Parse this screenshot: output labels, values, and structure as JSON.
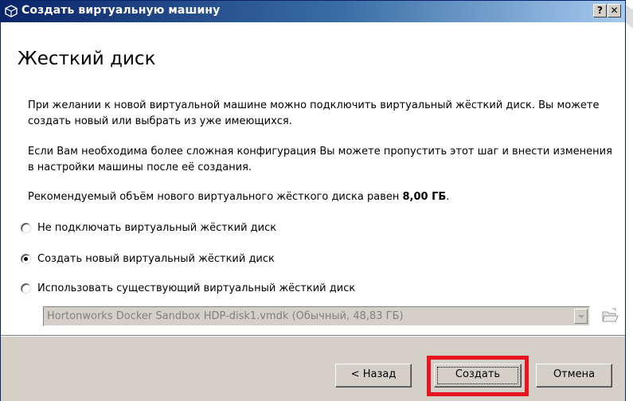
{
  "window": {
    "title": "Создать виртуальную машину",
    "help_label": "?",
    "close_label": "✕"
  },
  "page": {
    "heading": "Жесткий диск",
    "para1": "При желании к новой виртуальной машине можно подключить виртуальный жёсткий диск. Вы можете создать новый или выбрать из уже имеющихся.",
    "para2": "Если Вам необходима более сложная конфигурация Вы можете пропустить этот шаг и внести изменения в настройки машины после её создания.",
    "recommended_prefix": "Рекомендуемый объём нового виртуального жёсткого диска равен ",
    "recommended_size": "8,00 ГБ",
    "recommended_suffix": "."
  },
  "options": [
    {
      "label": "Не подключать виртуальный жёсткий диск",
      "checked": false
    },
    {
      "label": "Создать новый виртуальный жёсткий диск",
      "checked": true
    },
    {
      "label": "Использовать существующий виртуальный жёсткий диск",
      "checked": false
    }
  ],
  "disk_select": {
    "value": "Hortonworks Docker Sandbox HDP-disk1.vmdk (Обычный, 48,83 ГБ)",
    "enabled": false
  },
  "buttons": {
    "back": "< Назад",
    "create": "Создать",
    "cancel": "Отмена"
  },
  "colors": {
    "title_gradient_start": "#0a246a",
    "title_gradient_end": "#a6caf0",
    "dialog_face": "#d4d0c8",
    "highlight_border": "#e8141e"
  },
  "icons": {
    "title": "virtualbox-cube-icon",
    "folder": "folder-open-icon",
    "dropdown": "chevron-down-icon"
  }
}
